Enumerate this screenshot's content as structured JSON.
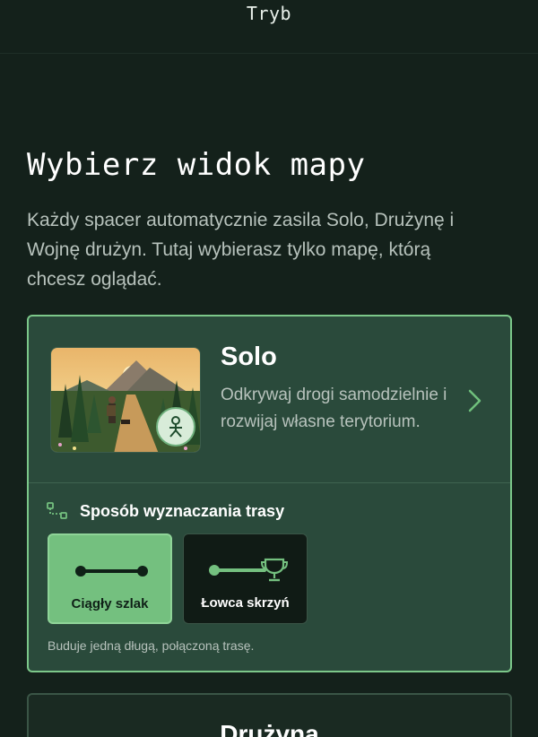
{
  "header": {
    "title": "Tryb"
  },
  "page": {
    "title": "Wybierz widok mapy",
    "intro": "Każdy spacer automatycznie zasila Solo, Drużynę i Wojnę drużyn. Tutaj wybierasz tylko mapę, którą chcesz oglądać."
  },
  "solo": {
    "title": "Solo",
    "description": "Odkrywaj drogi samodzielnie i rozwijaj własne terytorium.",
    "badge_icon": "person-icon",
    "chevron_icon": "chevron-right-icon",
    "route": {
      "heading": "Sposób wyznaczania trasy",
      "heading_icon": "route-icon",
      "options": [
        {
          "label": "Ciągły szlak",
          "selected": true,
          "icon": "continuous-line-icon"
        },
        {
          "label": "Łowca skrzyń",
          "selected": false,
          "icon": "trophy-line-icon"
        }
      ],
      "hint": "Buduje jedną długą, połączoną trasę."
    }
  },
  "team": {
    "title": "Drużyna"
  },
  "colors": {
    "background": "#14211b",
    "card": "#2a4a3b",
    "accent": "#74c07f",
    "border_active": "#7cc88a"
  }
}
